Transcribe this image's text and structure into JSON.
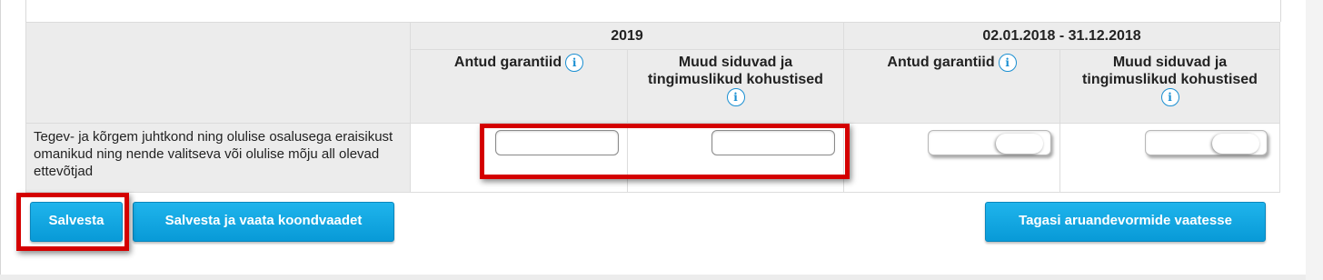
{
  "table": {
    "period_1": "2019",
    "period_2": "02.01.2018 - 31.12.2018",
    "col_guarantees": "Antud garantiid",
    "col_other_line1": "Muud siduvad ja",
    "col_other_line2": "tingimuslikud kohustised",
    "row_label": "Tegev- ja kõrgem juhtkond ning olulise osalusega eraisikust omanikud ning nende valitseva või olulise mõju all olevad ettevõtjad",
    "inputs": {
      "y2019_guarantees": "",
      "y2019_other": "",
      "y2018_guarantees": "",
      "y2018_other": ""
    },
    "info_glyph": "i"
  },
  "buttons": {
    "save": "Salvesta",
    "save_and_view": "Salvesta ja vaata koondvaadet",
    "back": "Tagasi aruandevormide vaatesse"
  },
  "colors": {
    "button": "#089ad7",
    "highlight": "#d40000",
    "header_bg": "#ececec",
    "info_icon": "#1a8fd2"
  },
  "icons": [
    "info-icon"
  ]
}
